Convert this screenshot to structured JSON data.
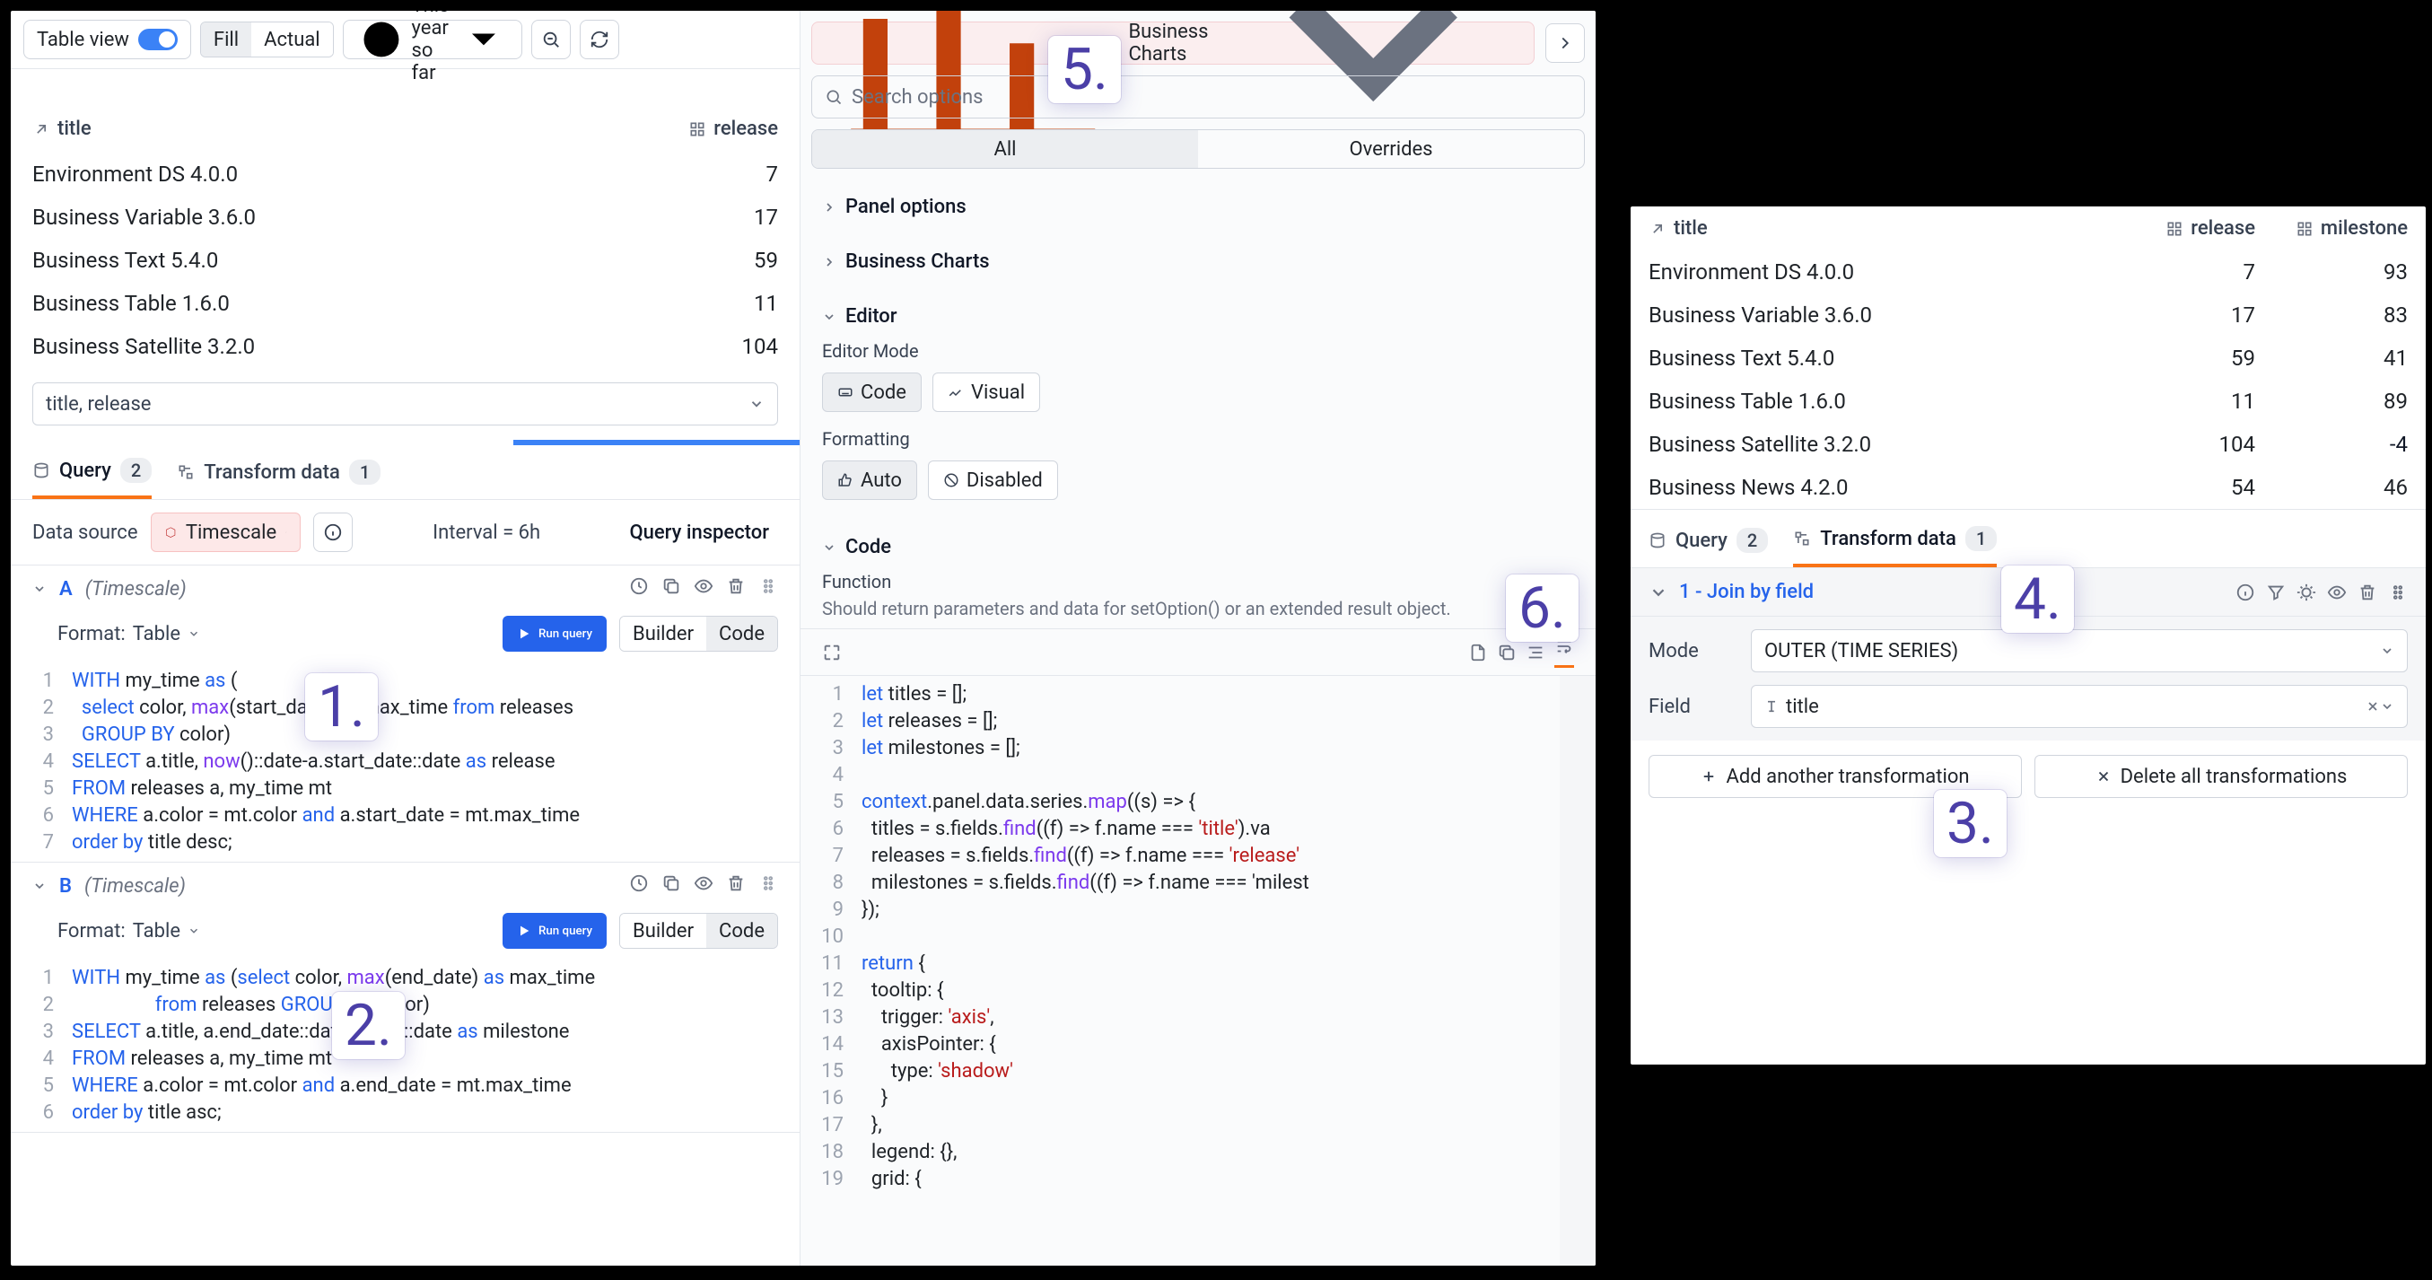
{
  "toolbar": {
    "table_view_label": "Table view",
    "fill": "Fill",
    "actual": "Actual",
    "time_range": "This year so far"
  },
  "table": {
    "col_title": "title",
    "col_release": "release",
    "rows": [
      {
        "title": "Environment DS 4.0.0",
        "release": 7
      },
      {
        "title": "Business Variable 3.6.0",
        "release": 17
      },
      {
        "title": "Business Text 5.4.0",
        "release": 59
      },
      {
        "title": "Business Table 1.6.0",
        "release": 11
      },
      {
        "title": "Business Satellite 3.2.0",
        "release": 104
      }
    ],
    "selector": "title, release"
  },
  "tabs": {
    "query": "Query",
    "query_count": "2",
    "transform": "Transform data",
    "transform_count": "1"
  },
  "datasource": {
    "label": "Data source",
    "name": "Timescale",
    "interval": "Interval = 6h",
    "inspector": "Query inspector"
  },
  "queryA": {
    "name": "A",
    "src": "(Timescale)",
    "format_label": "Format:",
    "format_value": "Table",
    "run": "Run query",
    "builder": "Builder",
    "code": "Code",
    "lines": [
      "WITH my_time as (",
      "  select color, max(start_date) as max_time from releases",
      "  GROUP BY color)",
      "SELECT a.title, now()::date-a.start_date::date as release",
      "FROM releases a, my_time mt",
      "WHERE a.color = mt.color and a.start_date = mt.max_time",
      "order by title desc;"
    ]
  },
  "queryB": {
    "name": "B",
    "src": "(Timescale)",
    "format_label": "Format:",
    "format_value": "Table",
    "run": "Run query",
    "builder": "Builder",
    "code": "Code",
    "lines": [
      "WITH my_time as (select color, max(end_date) as max_time",
      "                 from releases GROUP BY color)",
      "SELECT a.title, a.end_date::date-now()::date as milestone",
      "FROM releases a, my_time mt",
      "WHERE a.color = mt.color and a.end_date = mt.max_time",
      "order by title asc;"
    ]
  },
  "vis": {
    "chip": "Business Charts",
    "search_ph": "Search options",
    "tab_all": "All",
    "tab_ovr": "Overrides",
    "sec_panel": "Panel options",
    "sec_charts": "Business Charts",
    "sec_editor": "Editor",
    "editor_mode_label": "Editor Mode",
    "code": "Code",
    "visual": "Visual",
    "formatting_label": "Formatting",
    "auto": "Auto",
    "disabled": "Disabled",
    "sec_code": "Code",
    "fn_label": "Function",
    "fn_hint": "Should return parameters and data for setOption() or an extended result object."
  },
  "codeFn": {
    "lines": [
      "let titles = [];",
      "let releases = [];",
      "let milestones = [];",
      "",
      "context.panel.data.series.map((s) => {",
      "  titles = s.fields.find((f) => f.name === 'title').va",
      "  releases = s.fields.find((f) => f.name === 'release'",
      "  milestones = s.fields.find((f) => f.name === 'milest",
      "});",
      "",
      "return {",
      "  tooltip: {",
      "    trigger: 'axis',",
      "    axisPointer: {",
      "      type: 'shadow'",
      "    }",
      "  },",
      "  legend: {},",
      "  grid: {"
    ]
  },
  "rtable": {
    "col_title": "title",
    "col_release": "release",
    "col_milestone": "milestone",
    "rows": [
      {
        "title": "Environment DS 4.0.0",
        "release": 7,
        "milestone": 93
      },
      {
        "title": "Business Variable 3.6.0",
        "release": 17,
        "milestone": 83
      },
      {
        "title": "Business Text 5.4.0",
        "release": 59,
        "milestone": 41
      },
      {
        "title": "Business Table 1.6.0",
        "release": 11,
        "milestone": 89
      },
      {
        "title": "Business Satellite 3.2.0",
        "release": 104,
        "milestone": "-4"
      },
      {
        "title": "Business News 4.2.0",
        "release": 54,
        "milestone": 46
      }
    ]
  },
  "rtabs": {
    "query": "Query",
    "query_count": "2",
    "transform": "Transform data",
    "transform_count": "1"
  },
  "xform": {
    "title": "1 - Join by field",
    "mode_label": "Mode",
    "mode_value": "OUTER (TIME SERIES)",
    "field_label": "Field",
    "field_value": "title",
    "add": "Add another transformation",
    "del": "Delete all transformations"
  },
  "annotations": {
    "n1": "1.",
    "n2": "2.",
    "n3": "3.",
    "n4": "4.",
    "n5": "5.",
    "n6": "6."
  }
}
